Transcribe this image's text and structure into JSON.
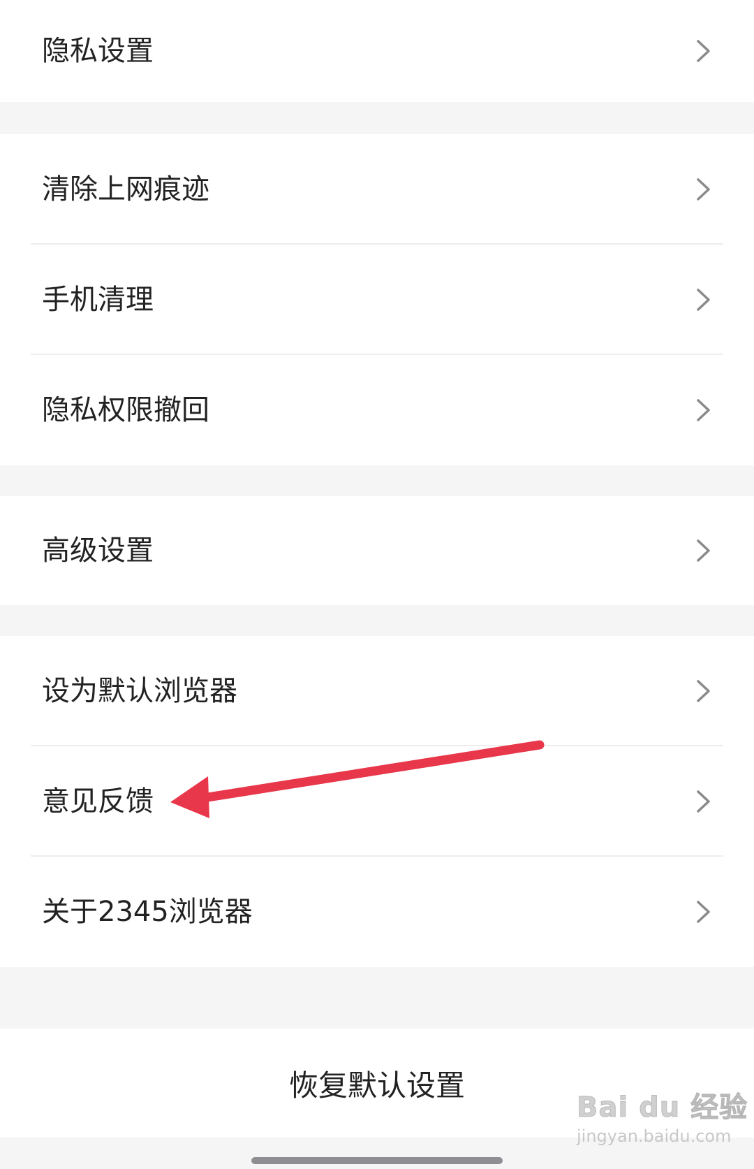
{
  "groups": [
    {
      "items": [
        {
          "label": "隐私设置"
        }
      ]
    },
    {
      "items": [
        {
          "label": "清除上网痕迹"
        },
        {
          "label": "手机清理"
        },
        {
          "label": "隐私权限撤回"
        }
      ]
    },
    {
      "items": [
        {
          "label": "高级设置"
        }
      ]
    },
    {
      "items": [
        {
          "label": "设为默认浏览器"
        },
        {
          "label": "意见反馈"
        },
        {
          "label": "关于2345浏览器"
        }
      ]
    }
  ],
  "reset": {
    "label": "恢复默认设置"
  },
  "annotation": {
    "target": "意见反馈",
    "color": "#e8374a"
  },
  "watermark": {
    "brand": "Bai du 经验",
    "url": "jingyan.baidu.com"
  }
}
